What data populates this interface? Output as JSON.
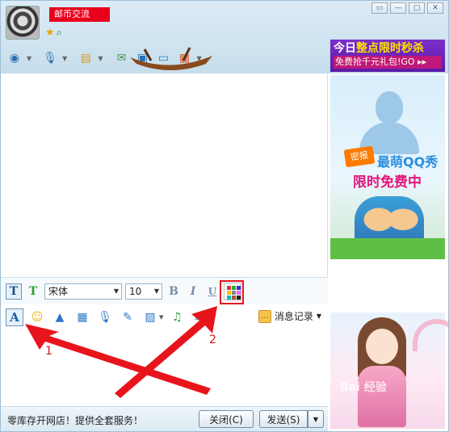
{
  "header": {
    "contact_name": "邮币交流",
    "window_controls": [
      "▭",
      "—",
      "▢",
      "✕"
    ]
  },
  "ads": {
    "top_line1_a": "今日",
    "top_line1_b": "整点限时秒杀",
    "top_line2": "免费抢千元礼包!GO ▸▸",
    "right_tag": "密报",
    "right_title1": "最萌QQ秀",
    "right_title2": "限时免费中",
    "watermark": "Bai 经验"
  },
  "format_bar": {
    "font_name": "宋体",
    "font_size": "10",
    "bold": "B",
    "italic": "I",
    "underline": "U"
  },
  "toolbar2": {
    "font_button": "A",
    "history_label": "消息记录"
  },
  "annotations": {
    "label1": "1",
    "label2": "2"
  },
  "bottom": {
    "promo_text": "零库存开网店！提供全套服务！",
    "close_label": "关闭(C)",
    "send_label": "发送(S)"
  },
  "colors": {
    "annotation_red": "#e8141c"
  }
}
